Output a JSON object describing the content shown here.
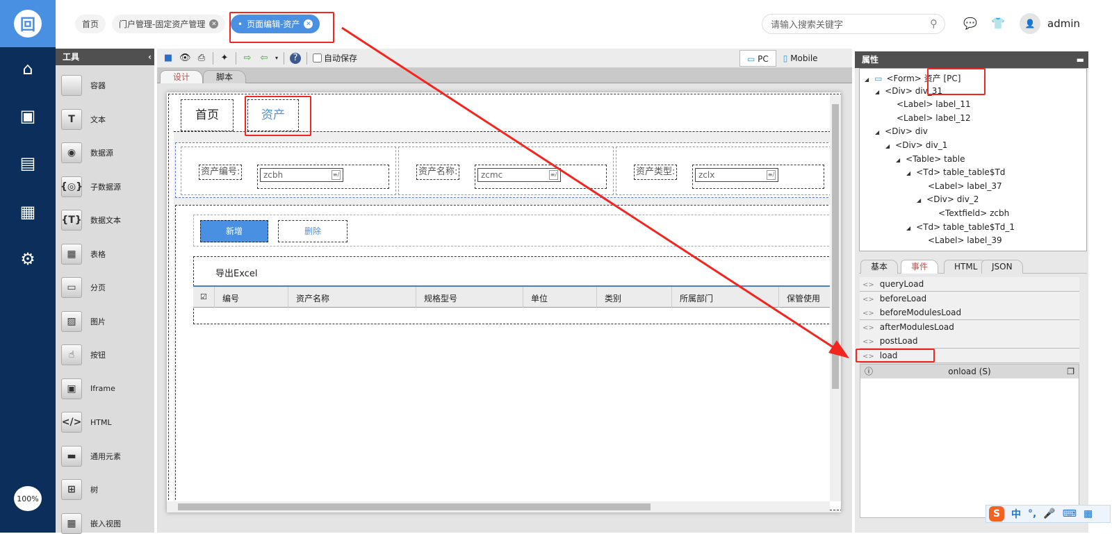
{
  "header": {
    "tabs": [
      {
        "label": "首页"
      },
      {
        "label": "门户管理-固定资产管理"
      },
      {
        "label": "页面编辑-资产"
      }
    ],
    "search_placeholder": "请输入搜索关键字",
    "user": "admin"
  },
  "nav": {
    "zoom": "100%"
  },
  "tools": {
    "title": "工具",
    "items": [
      "容器",
      "文本",
      "数据源",
      "子数据源",
      "数据文本",
      "表格",
      "分页",
      "图片",
      "按钮",
      "Iframe",
      "HTML",
      "通用元素",
      "树",
      "嵌入视图"
    ]
  },
  "toolbar": {
    "autosave": "自动保存",
    "device_pc": "PC",
    "device_mobile": "Mobile"
  },
  "doc_tabs": [
    "设计",
    "脚本"
  ],
  "canvas": {
    "page_tabs": [
      "首页",
      "资产"
    ],
    "fields": [
      {
        "label": "资产编号:",
        "value": "zcbh"
      },
      {
        "label": "资产名称:",
        "value": "zcmc"
      },
      {
        "label": "资产类型:",
        "value": "zclx"
      }
    ],
    "add": "新增",
    "delete": "删除",
    "export": "导出Excel",
    "columns": [
      "编号",
      "资产名称",
      "规格型号",
      "单位",
      "类别",
      "所属部门",
      "保管使用"
    ]
  },
  "props": {
    "title": "属性",
    "tree": [
      "<Form> 资产 [PC]",
      "<Div> div_31",
      "<Label> label_11",
      "<Label> label_12",
      "<Div> div",
      "<Div> div_1",
      "<Table> table",
      "<Td> table_table$Td",
      "<Label> label_37",
      "<Div> div_2",
      "<Textfield> zcbh",
      "<Td> table_table$Td_1",
      "<Label> label_39"
    ],
    "tabs": [
      "基本",
      "事件",
      "HTML",
      "JSON"
    ],
    "events": [
      "queryLoad",
      "beforeLoad",
      "beforeModulesLoad",
      "afterModulesLoad",
      "postLoad",
      "load"
    ],
    "editor_title": "onload (S)"
  },
  "ime": {
    "lang": "中"
  }
}
